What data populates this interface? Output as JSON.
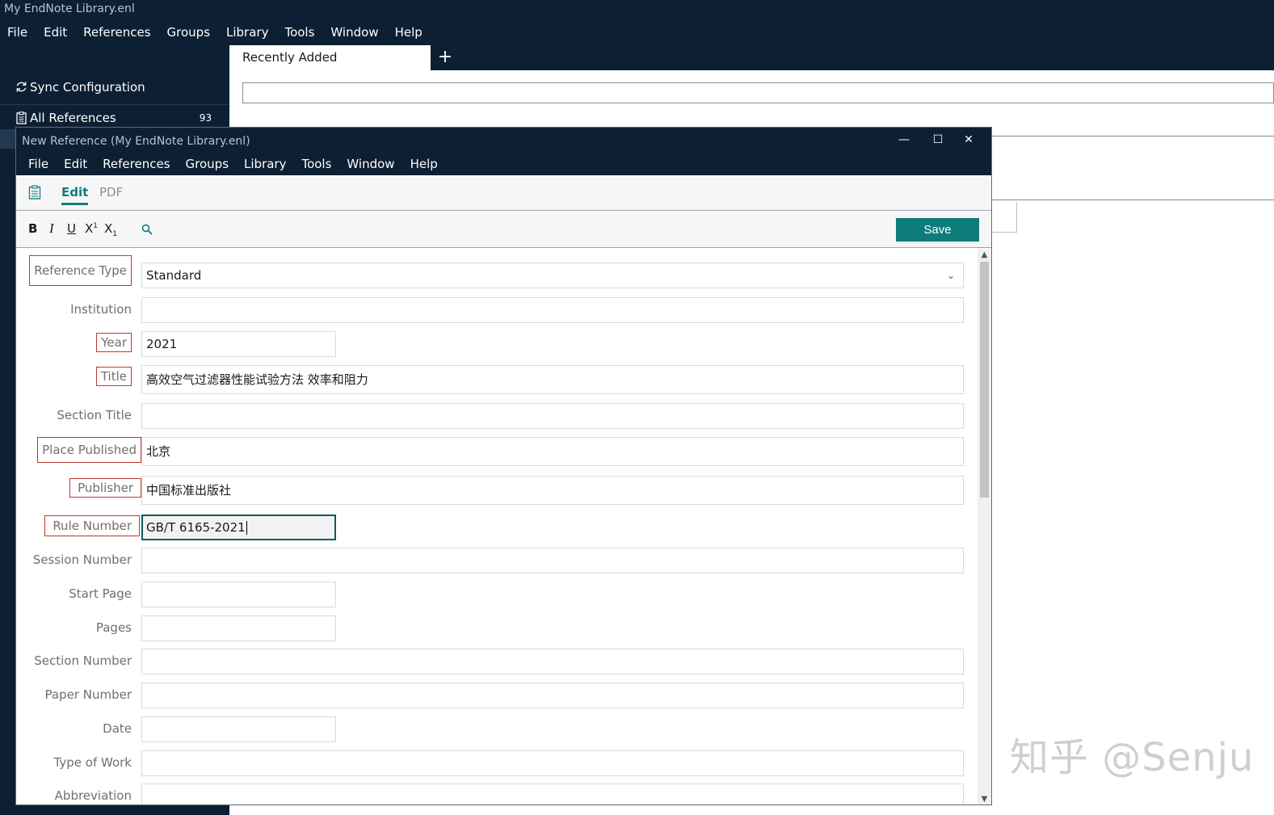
{
  "main_window": {
    "title": "My EndNote Library.enl",
    "menu": [
      "File",
      "Edit",
      "References",
      "Groups",
      "Library",
      "Tools",
      "Window",
      "Help"
    ],
    "sidebar": {
      "sync_label": "Sync Configuration",
      "all_refs_label": "All References",
      "all_refs_count": "93"
    },
    "tab_label": "Recently Added",
    "add_tab_symbol": "+"
  },
  "dialog": {
    "title": "New Reference (My EndNote Library.enl)",
    "menu": [
      "File",
      "Edit",
      "References",
      "Groups",
      "Library",
      "Tools",
      "Window",
      "Help"
    ],
    "controls": {
      "minimize": "—",
      "maximize": "☐",
      "close": "✕"
    },
    "tabs": {
      "edit": "Edit",
      "pdf": "PDF"
    },
    "toolbar": {
      "bold": "B",
      "italic": "I",
      "underline": "U",
      "superscript": "X",
      "sup_mark": "1",
      "subscript": "X",
      "sub_mark": "1",
      "save_label": "Save"
    },
    "fields": {
      "reference_type": {
        "label": "Reference Type",
        "value": "Standard"
      },
      "institution": {
        "label": "Institution",
        "value": ""
      },
      "year": {
        "label": "Year",
        "value": "2021"
      },
      "title": {
        "label": "Title",
        "value": "高效空气过滤器性能试验方法 效率和阻力"
      },
      "section_title": {
        "label": "Section Title",
        "value": ""
      },
      "place_published": {
        "label": "Place Published",
        "value": "北京"
      },
      "publisher": {
        "label": "Publisher",
        "value": "中国标准出版社"
      },
      "rule_number": {
        "label": "Rule Number",
        "value": "GB/T 6165-2021"
      },
      "session_number": {
        "label": "Session Number",
        "value": ""
      },
      "start_page": {
        "label": "Start Page",
        "value": ""
      },
      "pages": {
        "label": "Pages",
        "value": ""
      },
      "section_number": {
        "label": "Section Number",
        "value": ""
      },
      "paper_number": {
        "label": "Paper Number",
        "value": ""
      },
      "date": {
        "label": "Date",
        "value": ""
      },
      "type_of_work": {
        "label": "Type of Work",
        "value": ""
      },
      "abbreviation": {
        "label": "Abbreviation",
        "value": ""
      }
    }
  },
  "watermark": "知乎 @Senju",
  "colors": {
    "navy": "#0d1f33",
    "teal": "#0e7c7b",
    "highlight_red": "#c0392b"
  }
}
